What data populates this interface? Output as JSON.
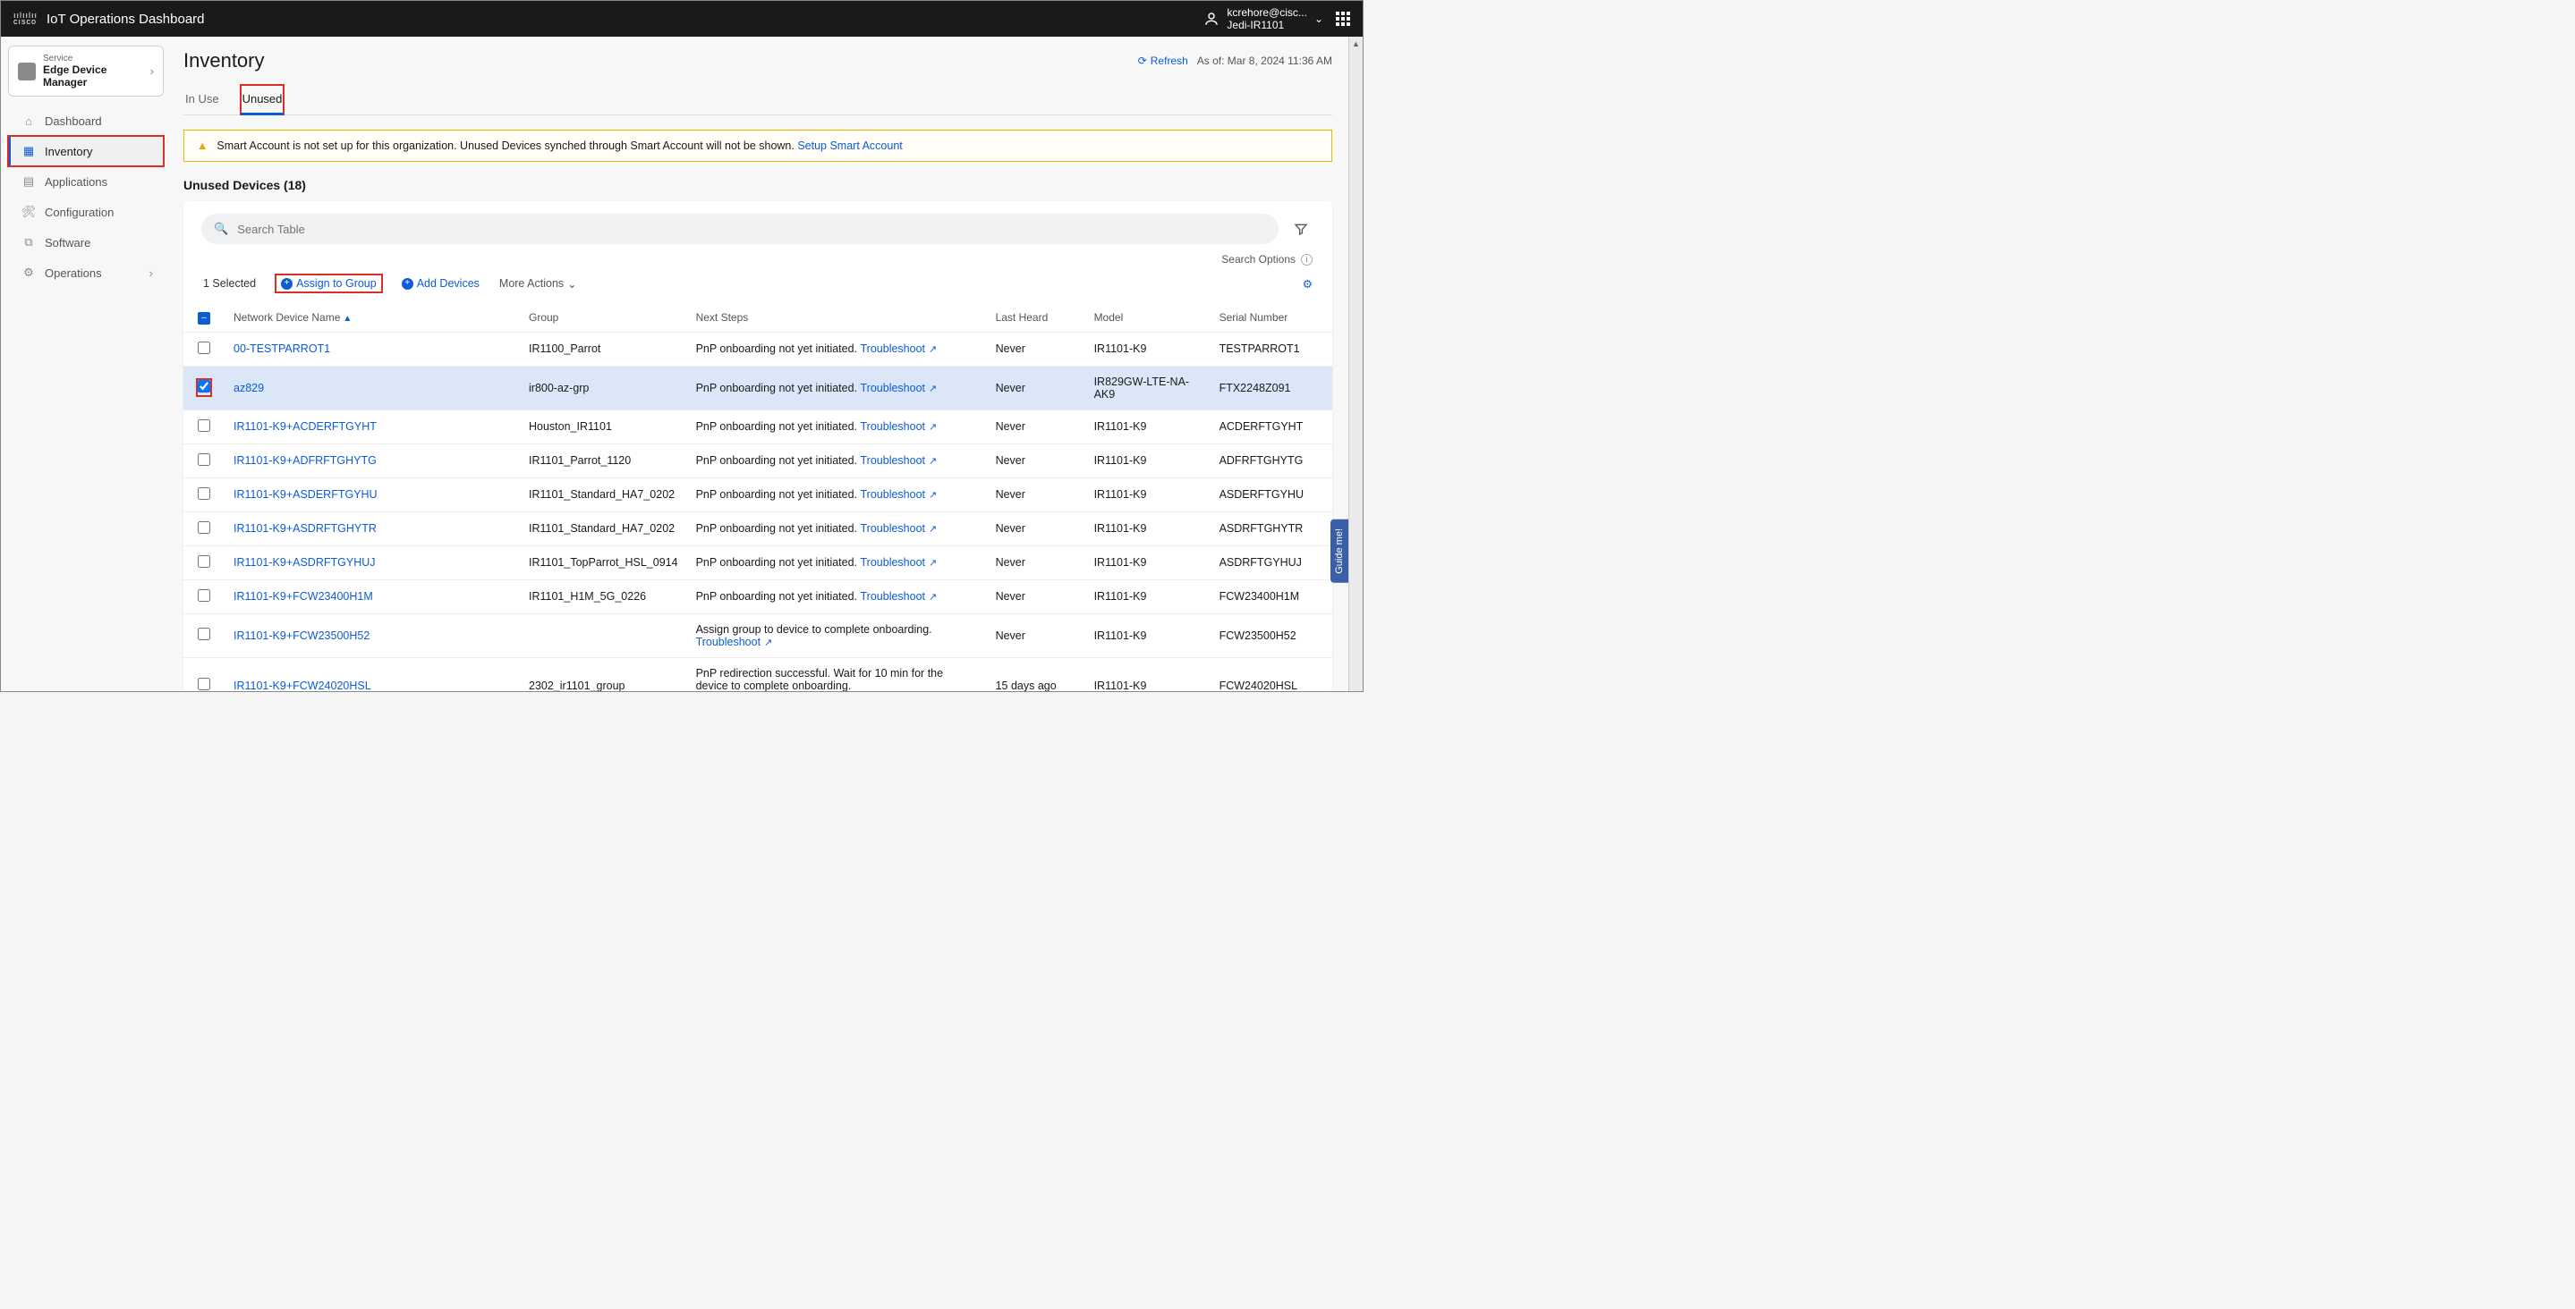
{
  "brand": {
    "logo_top": "ıılıılıı",
    "logo_bottom": "cısco",
    "title": "IoT Operations Dashboard"
  },
  "user": {
    "name": "kcrehore@cisc...",
    "org": "Jedi-IR1101"
  },
  "service": {
    "label": "Service",
    "name": "Edge Device Manager"
  },
  "nav": {
    "dashboard": "Dashboard",
    "inventory": "Inventory",
    "applications": "Applications",
    "configuration": "Configuration",
    "software": "Software",
    "operations": "Operations"
  },
  "page": {
    "title": "Inventory",
    "refresh": "Refresh",
    "asof": "As of: Mar 8, 2024 11:36 AM"
  },
  "tabs": {
    "inuse": "In Use",
    "unused": "Unused"
  },
  "alert": {
    "text": "Smart Account is not set up for this organization. Unused Devices synched through Smart Account will not be shown. ",
    "link": "Setup Smart Account"
  },
  "section": {
    "title": "Unused Devices (18)"
  },
  "search": {
    "placeholder": "Search Table",
    "options": "Search Options"
  },
  "toolbar": {
    "selected": "1 Selected",
    "assign": "Assign to Group",
    "add": "Add Devices",
    "more": "More Actions"
  },
  "columns": {
    "name": "Network Device Name",
    "group": "Group",
    "next": "Next Steps",
    "heard": "Last Heard",
    "model": "Model",
    "serial": "Serial Number"
  },
  "ts": "Troubleshoot",
  "rows": [
    {
      "name": "00-TESTPARROT1",
      "group": "IR1100_Parrot",
      "next": "PnP onboarding not yet initiated. ",
      "ts": true,
      "heard": "Never",
      "model": "IR1101-K9",
      "serial": "TESTPARROT1",
      "selected": false
    },
    {
      "name": "az829",
      "group": "ir800-az-grp",
      "next": "PnP onboarding not yet initiated. ",
      "ts": true,
      "heard": "Never",
      "model": "IR829GW-LTE-NA-AK9",
      "serial": "FTX2248Z091",
      "selected": true
    },
    {
      "name": "IR1101-K9+ACDERFTGYHT",
      "group": "Houston_IR1101",
      "next": "PnP onboarding not yet initiated. ",
      "ts": true,
      "heard": "Never",
      "model": "IR1101-K9",
      "serial": "ACDERFTGYHT",
      "selected": false
    },
    {
      "name": "IR1101-K9+ADFRFTGHYTG",
      "group": "IR1101_Parrot_1120",
      "next": "PnP onboarding not yet initiated. ",
      "ts": true,
      "heard": "Never",
      "model": "IR1101-K9",
      "serial": "ADFRFTGHYTG",
      "selected": false
    },
    {
      "name": "IR1101-K9+ASDERFTGYHU",
      "group": "IR1101_Standard_HA7_0202",
      "next": "PnP onboarding not yet initiated. ",
      "ts": true,
      "heard": "Never",
      "model": "IR1101-K9",
      "serial": "ASDERFTGYHU",
      "selected": false
    },
    {
      "name": "IR1101-K9+ASDRFTGHYTR",
      "group": "IR1101_Standard_HA7_0202",
      "next": "PnP onboarding not yet initiated. ",
      "ts": true,
      "heard": "Never",
      "model": "IR1101-K9",
      "serial": "ASDRFTGHYTR",
      "selected": false
    },
    {
      "name": "IR1101-K9+ASDRFTGYHUJ",
      "group": "IR1101_TopParrot_HSL_0914",
      "next": "PnP onboarding not yet initiated. ",
      "ts": true,
      "heard": "Never",
      "model": "IR1101-K9",
      "serial": "ASDRFTGYHUJ",
      "selected": false
    },
    {
      "name": "IR1101-K9+FCW23400H1M",
      "group": "IR1101_H1M_5G_0226",
      "next": "PnP onboarding not yet initiated. ",
      "ts": true,
      "heard": "Never",
      "model": "IR1101-K9",
      "serial": "FCW23400H1M",
      "selected": false
    },
    {
      "name": "IR1101-K9+FCW23500H52",
      "group": "",
      "next": "Assign group to device to complete onboarding. ",
      "ts": true,
      "ts_below": true,
      "heard": "Never",
      "model": "IR1101-K9",
      "serial": "FCW23500H52",
      "selected": false
    },
    {
      "name": "IR1101-K9+FCW24020HSL",
      "group": "2302_ir1101_group",
      "next": "PnP redirection successful. Wait for 10 min for the device to complete onboarding. ",
      "ts": true,
      "ts_below": true,
      "heard": "15 days ago",
      "model": "IR1101-K9",
      "serial": "FCW24020HSL",
      "selected": false
    }
  ],
  "guide": "Guide me!"
}
